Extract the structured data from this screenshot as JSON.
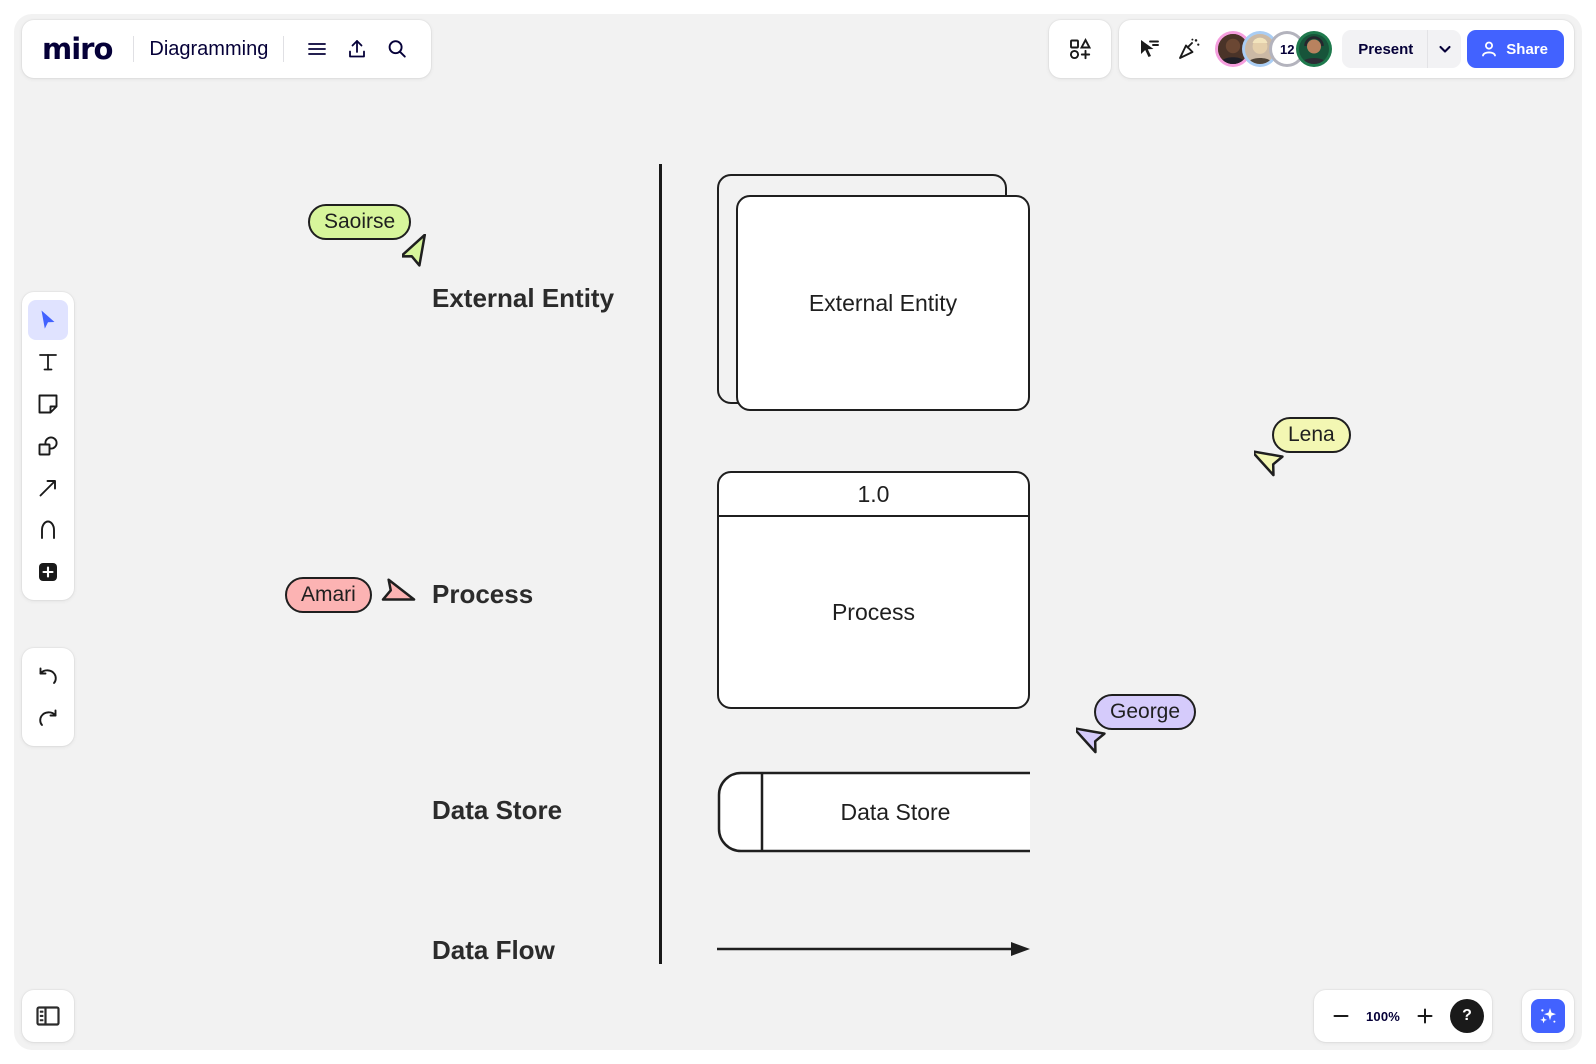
{
  "app": {
    "name": "miro",
    "board_title": "Diagramming",
    "background": "#f2f2f2"
  },
  "header": {
    "logo_text": "miro",
    "board_title": "Diagramming",
    "icons": [
      {
        "name": "menu-icon",
        "label": "Menu"
      },
      {
        "name": "export-icon",
        "label": "Export"
      },
      {
        "name": "search-icon",
        "label": "Search"
      }
    ],
    "right": {
      "templates_icon": "shapes-templates-icon",
      "cursor_chat_icon": "cursor-chat-icon",
      "celebration_icon": "celebration-icon",
      "collaborator_count": "12",
      "avatars": [
        {
          "name": "avatar-1",
          "ring_color": "#f59ede"
        },
        {
          "name": "avatar-2",
          "ring_color": "#a9cdf4"
        },
        {
          "name": "avatar-count",
          "ring_color": "#b3b3bd"
        },
        {
          "name": "avatar-3",
          "ring_color": "#1f7a4d"
        }
      ],
      "present_label": "Present",
      "share_label": "Share",
      "share_color": "#4262ff"
    }
  },
  "toolbar": {
    "items": [
      {
        "name": "tool-select",
        "label": "Select",
        "active": true
      },
      {
        "name": "tool-text",
        "label": "Text",
        "active": false
      },
      {
        "name": "tool-sticky-note",
        "label": "Sticky note",
        "active": false
      },
      {
        "name": "tool-shapes",
        "label": "Shapes",
        "active": false
      },
      {
        "name": "tool-connector",
        "label": "Connection line",
        "active": false
      },
      {
        "name": "tool-pen",
        "label": "Pen",
        "active": false
      },
      {
        "name": "tool-more",
        "label": "More apps",
        "active": false
      }
    ],
    "history": [
      {
        "name": "undo-button",
        "label": "Undo"
      },
      {
        "name": "redo-button",
        "label": "Redo"
      }
    ],
    "panel_toggle_label": "Toggle panel",
    "active_color": "#e0e3ff"
  },
  "zoom_bar": {
    "zoom_out_label": "Zoom out",
    "zoom_level": "100%",
    "zoom_in_label": "Zoom in",
    "help_label": "?",
    "ai_label": "Miro AI",
    "ai_color": "#4262ff"
  },
  "canvas": {
    "legend_rows": [
      {
        "name": "label-external-entity",
        "label": "External Entity"
      },
      {
        "name": "label-process",
        "label": "Process"
      },
      {
        "name": "label-data-store",
        "label": "Data Store"
      },
      {
        "name": "label-data-flow",
        "label": "Data Flow"
      }
    ],
    "shapes": {
      "external_entity": {
        "text": "External Entity"
      },
      "process": {
        "number": "1.0",
        "text": "Process"
      },
      "data_store": {
        "text": "Data Store"
      },
      "data_flow": {
        "text": ""
      }
    },
    "cursors": [
      {
        "name": "cursor-saoirse",
        "label": "Saoirse",
        "color": "#d7f59b",
        "direction": "down-right"
      },
      {
        "name": "cursor-amari",
        "label": "Amari",
        "color": "#fcb3b3",
        "direction": "right"
      },
      {
        "name": "cursor-lena",
        "label": "Lena",
        "color": "#f3f7b3",
        "direction": "down-left"
      },
      {
        "name": "cursor-george",
        "label": "George",
        "color": "#d5cbfb",
        "direction": "down-left"
      }
    ]
  }
}
